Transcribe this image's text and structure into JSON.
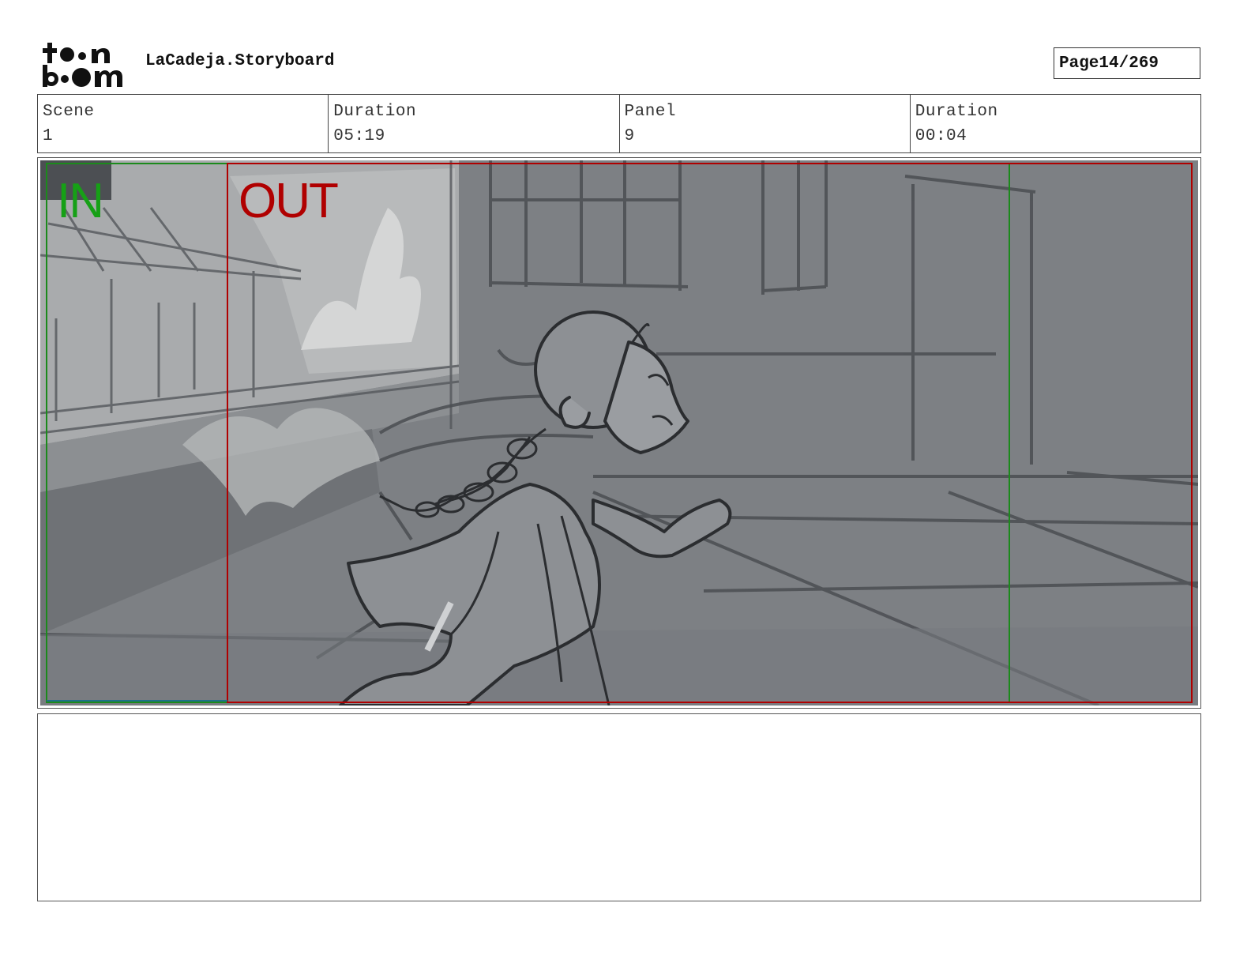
{
  "header": {
    "title": "LaCadeja.Storyboard",
    "page_label": "Page",
    "page_value": "14/269"
  },
  "info": [
    {
      "label": "Scene",
      "value": "1"
    },
    {
      "label": "Duration",
      "value": "05:19"
    },
    {
      "label": "Panel",
      "value": "9"
    },
    {
      "label": "Duration",
      "value": "00:04"
    }
  ],
  "panel": {
    "in_label": "IN",
    "out_label": "OUT"
  },
  "colors": {
    "in_marker": "#16a016",
    "out_marker": "#b00000",
    "panel_background": "#7d8084"
  },
  "notes": {
    "text": ""
  },
  "logo": {
    "icon": "toon-boom-logo"
  }
}
